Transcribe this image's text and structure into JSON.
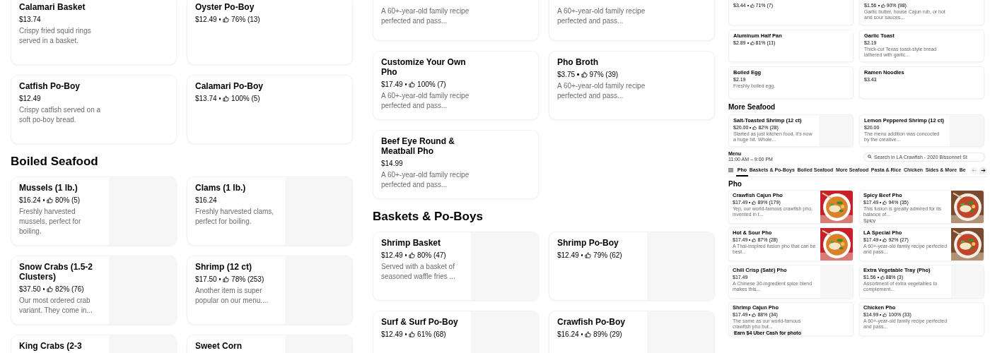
{
  "panels": [
    {
      "blocks": [
        {
          "kind": "grid",
          "cards": [
            {
              "title": "Calamari Basket",
              "price": "$13.74",
              "description": "Crispy fried squid rings served in a basket."
            },
            {
              "title": "Oyster Po-Boy",
              "price": "$12.49",
              "rating": "76% (13)"
            },
            {
              "title": "Catfish Po-Boy",
              "price": "$12.49",
              "description": "Crispy catfish served on a soft po-boy bread."
            },
            {
              "title": "Calamari Po-Boy",
              "price": "$13.74",
              "rating": "100% (5)"
            }
          ]
        },
        {
          "kind": "heading",
          "text": "Boiled Seafood"
        },
        {
          "kind": "grid",
          "cards": [
            {
              "title": "Mussels (1 lb.)",
              "price": "$16.24",
              "rating": "80% (5)",
              "description": "Freshly harvested mussels, perfect for boiling.",
              "media": {
                "kind": "placeholder"
              }
            },
            {
              "title": "Clams (1 lb.)",
              "price": "$16.24",
              "description": "Freshly harvested clams, perfect for boiling.",
              "media": {
                "kind": "placeholder"
              }
            },
            {
              "title": "Snow Crabs (1.5-2 Clusters)",
              "price": "$37.50",
              "rating": "82% (76)",
              "description": "Our most ordered crab variant. They come in...",
              "media": {
                "kind": "placeholder"
              }
            },
            {
              "title": "Shrimp (12 ct)",
              "price": "$17.50",
              "rating": "78% (253)",
              "description": "Another item is super popular on our menu....",
              "media": {
                "kind": "placeholder"
              }
            },
            {
              "title": "King Crabs (2-3",
              "media": {
                "kind": "placeholder"
              }
            },
            {
              "title": "Sweet Corn",
              "media": {
                "kind": "placeholder"
              }
            }
          ]
        }
      ]
    },
    {
      "blocks": [
        {
          "kind": "grid",
          "cards": [
            {
              "description": "A 60+-year-old family recipe perfected and pass..."
            },
            {
              "description": "A 60+-year-old family recipe perfected and pass..."
            },
            {
              "title": "Customize Your Own Pho",
              "price": "$17.49",
              "rating": "100% (7)",
              "description": "A 60+-year-old family recipe perfected and pass..."
            },
            {
              "title": "Pho Broth",
              "price": "$3.75",
              "rating": "97% (39)",
              "description": "A 60+-year-old family recipe perfected and pass..."
            },
            {
              "title": "Beef Eye Round & Meatball Pho",
              "price": "$14.99",
              "description": "A 60+-year-old family recipe perfected and pass..."
            }
          ]
        },
        {
          "kind": "heading",
          "text": "Baskets & Po-Boys"
        },
        {
          "kind": "grid",
          "cards": [
            {
              "title": "Shrimp Basket",
              "price": "$12.49",
              "rating": "80% (47)",
              "description": "Served with a basket of seasoned waffle fries ...",
              "media": {
                "kind": "placeholder"
              }
            },
            {
              "title": "Shrimp Po-Boy",
              "price": "$12.49",
              "rating": "79% (62)",
              "media": {
                "kind": "placeholder"
              }
            },
            {
              "title": "Surf & Surf Po-Boy",
              "price": "$12.49",
              "rating": "61% (68)",
              "media": {
                "kind": "placeholder"
              }
            },
            {
              "title": "Crawfish Po-Boy",
              "price": "$16.24",
              "rating": "89% (29)",
              "media": {
                "kind": "placeholder"
              }
            }
          ]
        }
      ]
    },
    {
      "blocks": [
        {
          "kind": "grid",
          "cards": [
            {
              "price": "$3.44",
              "rating": "71% (7)"
            },
            {
              "price": "$1.56",
              "rating": "90% (98)",
              "description": "Garlic butter, house Cajun rub, or hot and sour sauces..."
            },
            {
              "title": "Aluminum Half Pan",
              "price": "$2.89",
              "rating": "81% (11)"
            },
            {
              "title": "Garlic Toast",
              "price": "$2.19",
              "description": "Thick-cut Texas toast-style bread lathered with garlic..."
            },
            {
              "title": "Boiled Egg",
              "price": "$2.19",
              "description": "Freshly boiled egg."
            },
            {
              "title": "Ramen Noodles",
              "price": "$3.43"
            }
          ]
        },
        {
          "kind": "heading",
          "text": "More Seafood"
        },
        {
          "kind": "grid",
          "cards": [
            {
              "title": "Salt-Toasted Shrimp (12 ct)",
              "price": "$20.00",
              "rating": "82% (28)",
              "description": "Started as just kitchen food, it's now a huge hit. Whole...",
              "media": {
                "kind": "placeholder"
              }
            },
            {
              "title": "Lemon Peppered Shrimp (12 ct)",
              "price": "$20.00",
              "description": "The menu addition was concocted by the creative...",
              "media": {
                "kind": "placeholder"
              }
            }
          ]
        }
      ]
    }
  ],
  "store_view": {
    "label": "Menu",
    "hours": "11:00 AM – 9:00 PM",
    "search": {
      "placeholder": "Search in LA Crawfish - 2020 Bissonnet St"
    },
    "nav": [
      {
        "label": "Pho",
        "selected": true
      },
      {
        "label": "Baskets & Po-Boys",
        "selected": false
      },
      {
        "label": "Boiled Seafood",
        "selected": false
      },
      {
        "label": "More Seafood",
        "selected": false
      },
      {
        "label": "Pasta & Rice",
        "selected": false
      },
      {
        "label": "Chicken",
        "selected": false
      },
      {
        "label": "Sides & More",
        "selected": false
      },
      {
        "label": "Be",
        "selected": false
      }
    ],
    "arrows": [
      {
        "kind": "left",
        "disabled": true
      },
      {
        "kind": "right",
        "disabled": false
      }
    ],
    "section": "Pho",
    "cards": [
      {
        "title": "Crawfish Cajun Pho",
        "price": "$17.49",
        "rating": "89% (179)",
        "description": "Yep, our world-famous crawfish pho, invented in t..."
      },
      {
        "title": "Spicy Beef Pho",
        "price": "$17.49",
        "rating": "94% (35)",
        "description": "This fusion is greatly admired for its balance of...",
        "tag": {
          "kind": "label",
          "text": "Spicy"
        }
      },
      {
        "title": "Hot & Sour Pho",
        "price": "$17.49",
        "rating": "87% (28)",
        "description": "A Thai-inspired fusion pho that can be best..."
      },
      {
        "title": "LA Special Pho",
        "price": "$17.49",
        "rating": "92% (27)",
        "description": "A 60+-year-old family recipe perfected and pass..."
      },
      {
        "title": "Chili Crisp (Saté) Pho",
        "price": "$17.49",
        "description": "A Chinese 30-ingredient spice blend makes this...",
        "media": {
          "kind": "placeholder"
        }
      },
      {
        "title": "Extra Vegetable Tray (Pho)",
        "price": "$1.56",
        "rating": "88% (3)",
        "description": "Assortment of extra vegetables to complement...",
        "media": {
          "kind": "placeholder"
        }
      },
      {
        "title": "Shrimp Cajun Pho",
        "price": "$17.49",
        "rating": "88% (34)",
        "description": "The same as our world-famous crawfish pho but...",
        "tag": {
          "kind": "promo",
          "text": "Earn $4 Uber Cash for photo"
        }
      },
      {
        "title": "Chicken Pho",
        "price": "$14.99",
        "rating": "100% (33)",
        "description": "A 60+-year-old family recipe perfected and pass..."
      }
    ]
  }
}
